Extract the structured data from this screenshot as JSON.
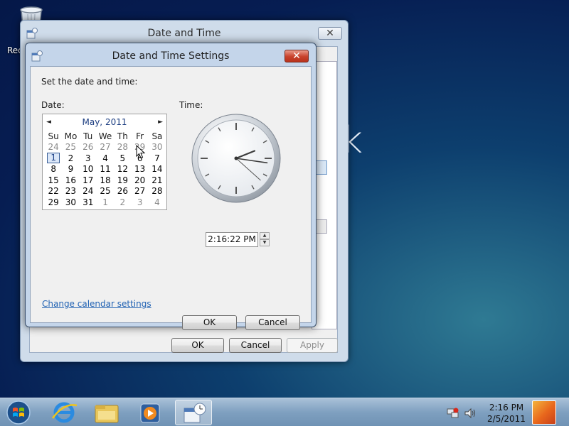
{
  "desktop": {
    "recycle_bin_label": "Rec",
    "background_text": "k"
  },
  "outer_window": {
    "title": "Date and Time",
    "close_glyph": "✕",
    "buttons": {
      "ok": "OK",
      "cancel": "Cancel",
      "apply": "Apply"
    }
  },
  "dialog": {
    "title": "Date and Time Settings",
    "close_glyph": "✕",
    "instruction": "Set the date and time:",
    "date_label": "Date:",
    "time_label": "Time:",
    "calendar": {
      "month_year": "May, 2011",
      "prev_glyph": "◄",
      "next_glyph": "►",
      "weekdays": [
        "Su",
        "Mo",
        "Tu",
        "We",
        "Th",
        "Fr",
        "Sa"
      ],
      "weeks": [
        [
          "24",
          "25",
          "26",
          "27",
          "28",
          "29",
          "30"
        ],
        [
          "1",
          "2",
          "3",
          "4",
          "5",
          "6",
          "7"
        ],
        [
          "8",
          "9",
          "10",
          "11",
          "12",
          "13",
          "14"
        ],
        [
          "15",
          "16",
          "17",
          "18",
          "19",
          "20",
          "21"
        ],
        [
          "22",
          "23",
          "24",
          "25",
          "26",
          "27",
          "28"
        ],
        [
          "29",
          "30",
          "31",
          "1",
          "2",
          "3",
          "4"
        ]
      ],
      "selected_day": "1"
    },
    "clock": {
      "hours": 2,
      "minutes": 16,
      "seconds": 22
    },
    "time_value": "2:16:22 PM",
    "spin_up": "▲",
    "spin_down": "▼",
    "calendar_link": "Change calendar settings",
    "buttons": {
      "ok": "OK",
      "cancel": "Cancel"
    }
  },
  "taskbar": {
    "time": "2:16 PM",
    "date": "2/5/2011",
    "apps": [
      "start-orb-icon",
      "internet-explorer-icon",
      "windows-explorer-icon",
      "media-player-icon",
      "date-time-icon"
    ]
  },
  "colors": {
    "accent_link": "#1f61b3",
    "close_red": "#c8412b",
    "month_blue": "#1e3f82"
  }
}
